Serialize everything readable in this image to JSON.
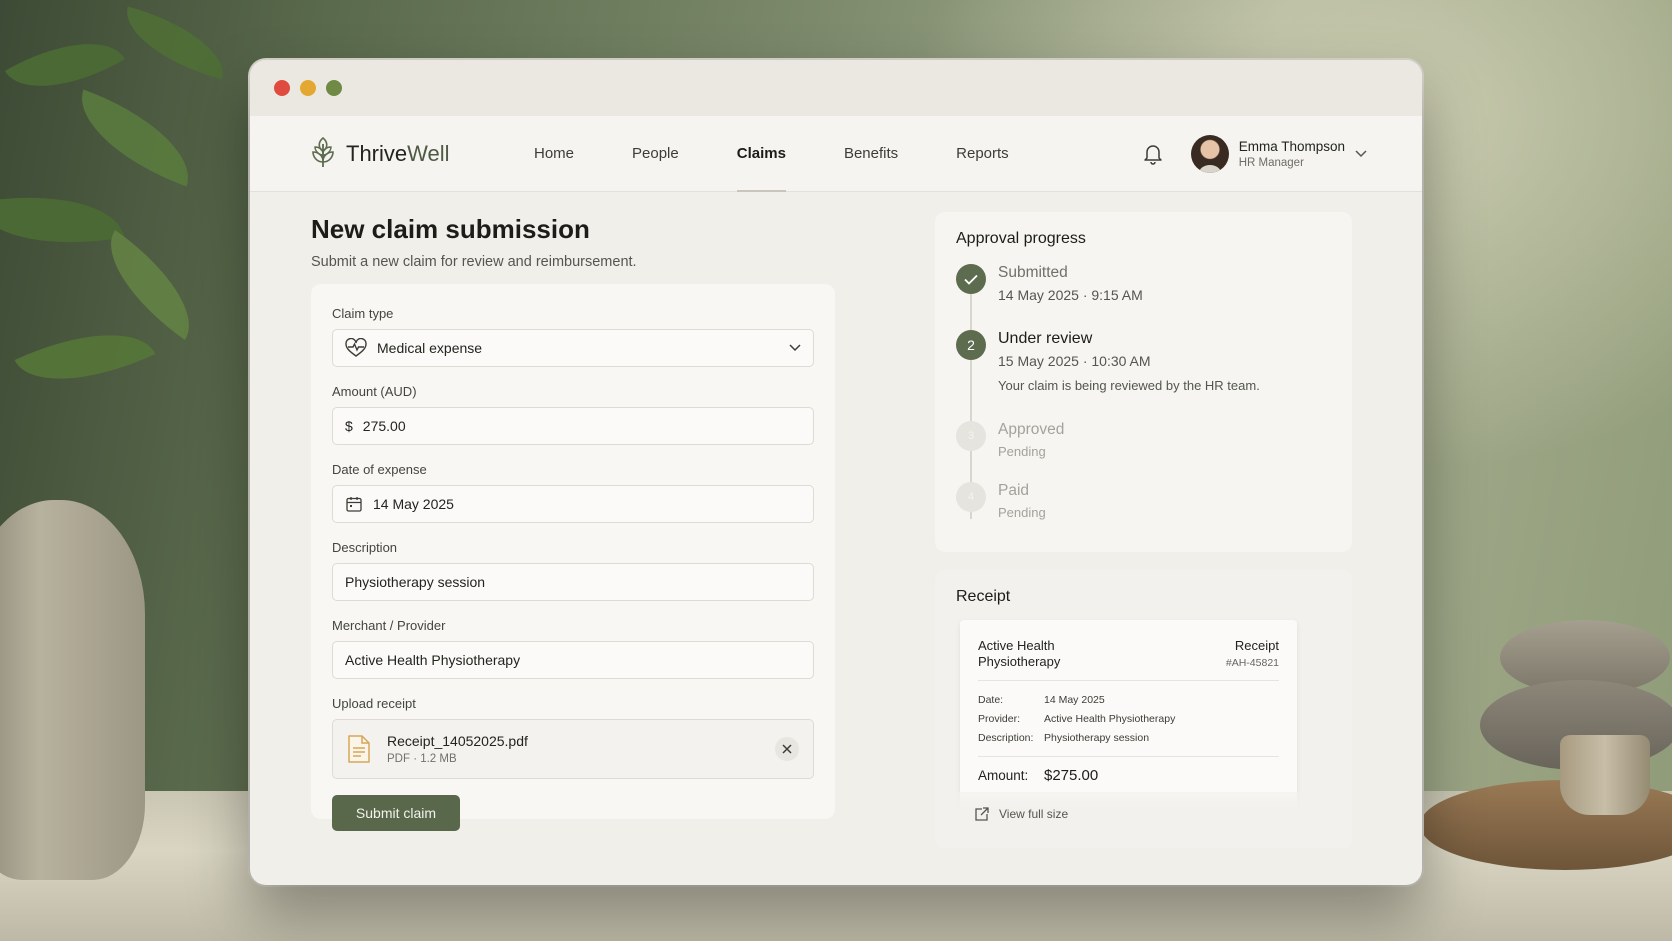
{
  "window": {
    "dots": [
      "close",
      "minimize",
      "maximize"
    ]
  },
  "brand": {
    "name_dark": "Thrive",
    "name_light": "Well"
  },
  "nav": {
    "items": [
      {
        "label": "Home",
        "active": false
      },
      {
        "label": "People",
        "active": false
      },
      {
        "label": "Claims",
        "active": true
      },
      {
        "label": "Benefits",
        "active": false
      },
      {
        "label": "Reports",
        "active": false
      }
    ]
  },
  "user": {
    "name": "Emma Thompson",
    "role": "HR Manager"
  },
  "page": {
    "title": "New claim submission",
    "subtitle": "Submit a new claim for review and reimbursement."
  },
  "form": {
    "claim_type": {
      "label": "Claim type",
      "value": "Medical expense"
    },
    "amount": {
      "label": "Amount (AUD)",
      "currency": "$",
      "value": "275.00"
    },
    "date": {
      "label": "Date of expense",
      "value": "14 May 2025"
    },
    "description": {
      "label": "Description",
      "value": "Physiotherapy session"
    },
    "merchant": {
      "label": "Merchant / Provider",
      "value": "Active Health Physiotherapy"
    },
    "upload": {
      "label": "Upload receipt",
      "file_name": "Receipt_14052025.pdf",
      "file_meta": "PDF · 1.2 MB"
    },
    "submit_label": "Submit claim"
  },
  "approval": {
    "title": "Approval progress",
    "steps": [
      {
        "number": "1",
        "title": "Submitted",
        "time": "14 May 2025 · 9:15 AM",
        "status": "done"
      },
      {
        "number": "2",
        "title": "Under review",
        "time": "15 May 2025 · 10:30 AM",
        "desc": "Your claim is being reviewed by the HR team.",
        "status": "current"
      },
      {
        "number": "3",
        "title": "Approved",
        "time": "Pending",
        "status": "pending"
      },
      {
        "number": "4",
        "title": "Paid",
        "time": "Pending",
        "status": "pending"
      }
    ]
  },
  "receipt": {
    "title": "Receipt",
    "provider": "Active Health Physiotherapy",
    "doc_title": "Receipt",
    "doc_number": "#AH-45821",
    "rows": [
      {
        "key": "Date:",
        "value": "14 May 2025"
      },
      {
        "key": "Provider:",
        "value": "Active Health Physiotherapy"
      },
      {
        "key": "Description:",
        "value": "Physiotherapy session"
      }
    ],
    "amount_key": "Amount:",
    "amount_value": "$275.00",
    "view_full": "View full size"
  },
  "colors": {
    "accent": "#59674a",
    "background": "#f1efea",
    "text": "#22241f"
  },
  "icons": [
    "leaf-logo-icon",
    "bell-icon",
    "chevron-down-icon",
    "heart-pulse-icon",
    "calendar-icon",
    "document-icon",
    "close-icon",
    "check-icon",
    "external-link-icon"
  ]
}
